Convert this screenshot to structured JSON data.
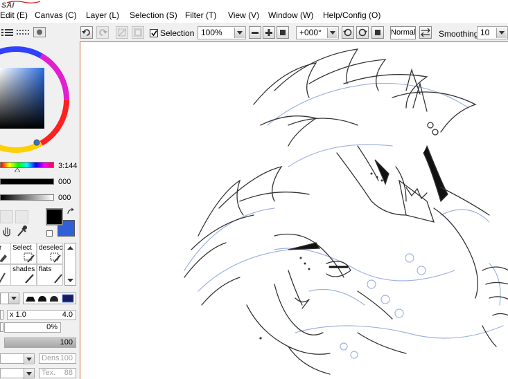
{
  "app": {
    "logo_text": "SAI"
  },
  "menu": {
    "items": [
      {
        "label": "Edit (E)"
      },
      {
        "label": "Canvas (C)"
      },
      {
        "label": "Layer (L)"
      },
      {
        "label": "Selection (S)"
      },
      {
        "label": "Filter (T)"
      },
      {
        "label": "View (V)"
      },
      {
        "label": "Window (W)"
      },
      {
        "label": "Help/Config (O)"
      }
    ]
  },
  "toolbar": {
    "selection_label": "Selection",
    "selection_checked": true,
    "zoom_value": "100%",
    "rotation_value": "+000°",
    "blend_mode": "Normal",
    "smoothing_label": "Smoothing",
    "smoothing_value": "10"
  },
  "color_panel": {
    "hue_value": "3:144",
    "slider2_value": "000",
    "slider3_value": "000",
    "primary_color": "#000000",
    "secondary_color": "#3060d8"
  },
  "tools": {
    "cells": [
      {
        "label": "r"
      },
      {
        "label": "Select"
      },
      {
        "label": "deselect"
      },
      {
        "label": ""
      },
      {
        "label": "shades"
      },
      {
        "label": "flats"
      }
    ]
  },
  "brush": {
    "size_multiplier": "x 1.0",
    "size_value": "4.0",
    "min_size": "0%",
    "density": "100",
    "dens_label": "Dens",
    "dens_value": "100",
    "tex_label": "Tex.",
    "tex_value": "88"
  },
  "colors": {
    "canvas_border": "#d06020",
    "accent": "#3060d8"
  }
}
